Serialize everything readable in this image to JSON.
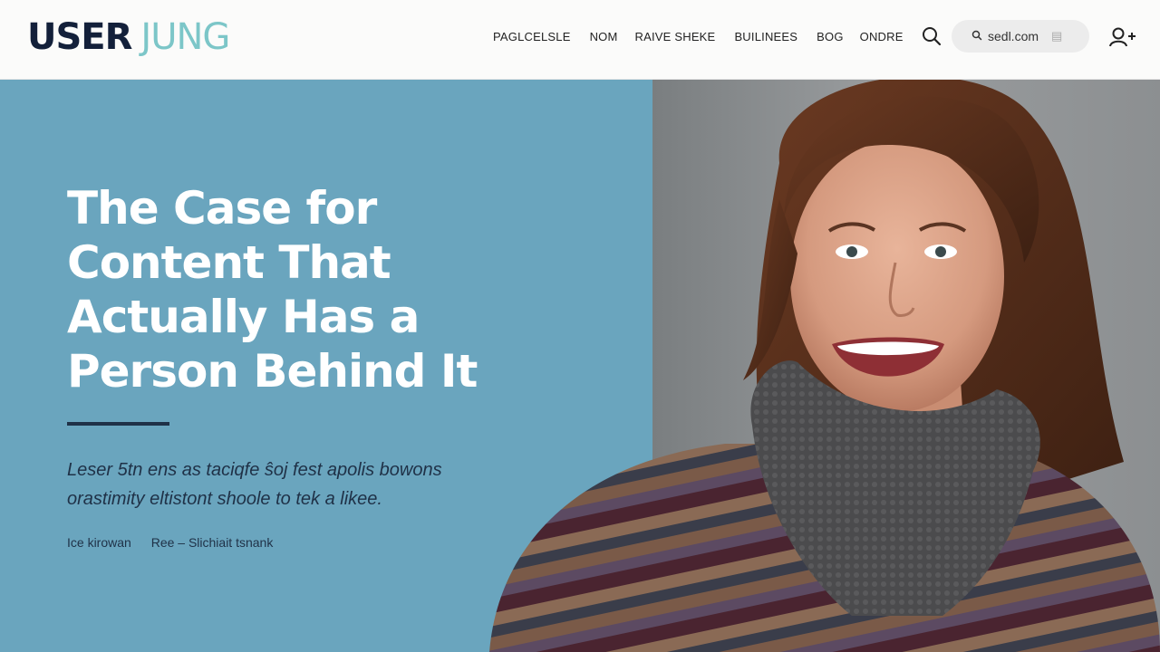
{
  "header": {
    "logo_part1": "USER",
    "logo_part2": "JUNG",
    "nav": [
      "PAGLCELSLE",
      "NOM",
      "RAIVE SHEKE",
      "BUILINEES",
      "BOG",
      "ONDRE"
    ],
    "search_text": "sedl.com"
  },
  "hero": {
    "title": "The Case for Content That Actually Has a Person Behind It",
    "subtitle": "Leser 5tn ens as taciqfe ŝoj fest apolis bowons orastimity eltistont shoole to tek a likee.",
    "meta": [
      "Ice kirowan",
      "Ree – Slichiait tsnank"
    ],
    "photo_subject": "smiling woman in striped sweater and grey knit scarf"
  },
  "icons": {
    "search": "search-icon",
    "user": "user-add-icon"
  },
  "colors": {
    "hero_left": "#6aa5be",
    "logo_dark": "#13203a",
    "logo_accent": "#7cc6c8",
    "rule": "#1f3147"
  }
}
